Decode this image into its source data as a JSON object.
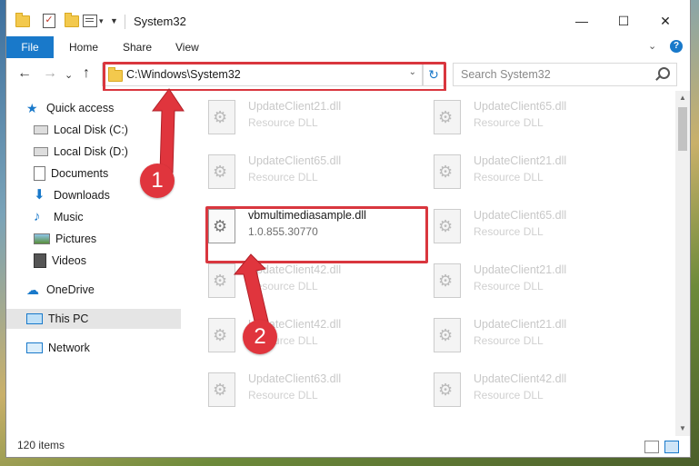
{
  "window": {
    "title": "System32"
  },
  "title_controls": {
    "minimize": "—",
    "maximize": "☐",
    "close": "✕"
  },
  "ribbon": {
    "file": "File",
    "tabs": [
      "Home",
      "Share",
      "View"
    ],
    "expand": "⌄",
    "help": "?"
  },
  "nav": {
    "back": "←",
    "forward": "→",
    "recent": "⌄",
    "up": "↑",
    "address": "C:\\Windows\\System32",
    "address_dropdown": "⌄",
    "refresh": "↻",
    "search_placeholder": "Search System32"
  },
  "sidebar": {
    "items": [
      {
        "label": "Quick access",
        "icon": "star-icon",
        "pinned": false
      },
      {
        "label": "Local Disk (C:)",
        "icon": "drive-icon",
        "pinned": true
      },
      {
        "label": "Local Disk (D:)",
        "icon": "drive-icon",
        "pinned": true
      },
      {
        "label": "Documents",
        "icon": "documents-icon",
        "pinned": true
      },
      {
        "label": "Downloads",
        "icon": "download-icon",
        "pinned": true
      },
      {
        "label": "Music",
        "icon": "music-icon",
        "pinned": true
      },
      {
        "label": "Pictures",
        "icon": "pictures-icon",
        "pinned": true
      },
      {
        "label": "Videos",
        "icon": "videos-icon",
        "pinned": true
      },
      {
        "label": "OneDrive",
        "icon": "cloud-icon",
        "pinned": false
      },
      {
        "label": "This PC",
        "icon": "computer-icon",
        "pinned": false,
        "selected": true
      },
      {
        "label": "Network",
        "icon": "network-icon",
        "pinned": false
      }
    ],
    "pin_glyph": "📌"
  },
  "files": [
    {
      "name": "UpdateClient21.dll",
      "type": "Resource DLL"
    },
    {
      "name": "UpdateClient65.dll",
      "type": "Resource DLL"
    },
    {
      "name": "UpdateClient65.dll",
      "type": "Resource DLL"
    },
    {
      "name": "UpdateClient21.dll",
      "type": "Resource DLL"
    },
    {
      "name": "vbmultimediasample.dll",
      "type": "1.0.855.30770",
      "highlighted": true
    },
    {
      "name": "UpdateClient65.dll",
      "type": "Resource DLL"
    },
    {
      "name": "UpdateClient42.dll",
      "type": "Resource DLL"
    },
    {
      "name": "UpdateClient21.dll",
      "type": "Resource DLL"
    },
    {
      "name": "UpdateClient42.dll",
      "type": "Resource DLL"
    },
    {
      "name": "UpdateClient21.dll",
      "type": "Resource DLL"
    },
    {
      "name": "UpdateClient63.dll",
      "type": "Resource DLL"
    },
    {
      "name": "UpdateClient42.dll",
      "type": "Resource DLL"
    }
  ],
  "status": {
    "count": "120 items"
  },
  "callouts": [
    "1",
    "2"
  ],
  "colors": {
    "accent": "#1979ca",
    "highlight": "#d9363e"
  }
}
